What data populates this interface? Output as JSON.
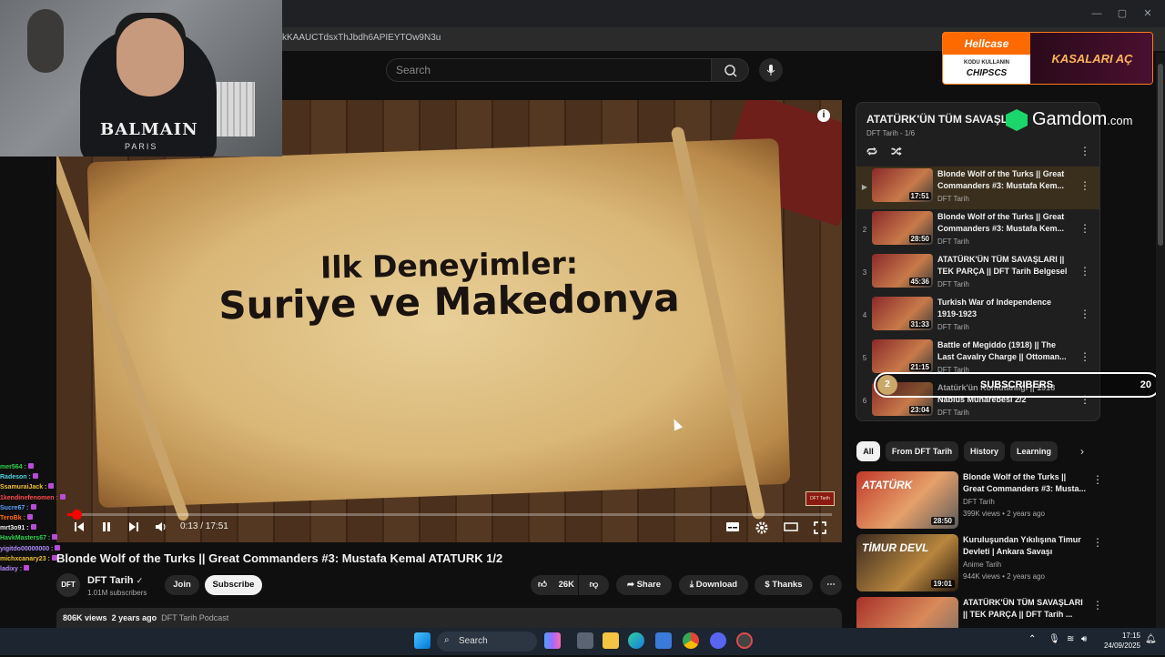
{
  "browser": {
    "url": "kKAAUCTdsxThJbdh6APIEYTOw9N3u",
    "window_controls": [
      "—",
      "▢",
      "✕"
    ]
  },
  "webcam": {
    "shirt_text": "BALMAIN",
    "shirt_sub": "PARIS"
  },
  "search": {
    "placeholder": "Search"
  },
  "ad_hellcase": {
    "brand": "Hellcase",
    "code_label": "KODU KULLANIN",
    "code": "CHIPSCS",
    "cta": "KASALARI AÇ"
  },
  "gamdom": {
    "name": "Gamdom",
    "suffix": ".com"
  },
  "player": {
    "overlay_line1": "Ilk Deneyimler:",
    "overlay_line2": "Suriye ve Makedonya",
    "time": "0:13 / 17:51",
    "progress": 0.012,
    "watermark": "DFT Tarih",
    "info_icon": "i"
  },
  "video": {
    "title": "Blonde Wolf of the Turks || Great Commanders #3: Mustafa Kemal ATATURK 1/2",
    "channel": "DFT Tarih",
    "channel_avatar": "DFT",
    "subscribers": "1.01M subscribers",
    "join": "Join",
    "subscribe": "Subscribe",
    "likes": "26K",
    "share": "Share",
    "download": "Download",
    "thanks": "Thanks",
    "views": "806K views",
    "age": "2 years ago",
    "playlist_link": "DFT Tarih Podcast"
  },
  "chat": [
    {
      "user": "mer564 :",
      "color": "#29d14a"
    },
    {
      "user": "Radeson :",
      "color": "#49d3e3"
    },
    {
      "user": "SsamuraiJack :",
      "color": "#f1c232"
    },
    {
      "user": "1kendinefenomen :",
      "color": "#ff4a4a"
    },
    {
      "user": "Sucre67 :",
      "color": "#5aa0ff"
    },
    {
      "user": "TeroBk :",
      "color": "#ff6a00"
    },
    {
      "user": "mrt3o91 :",
      "color": "#f1f1f1"
    },
    {
      "user": "HavkMasters67 :",
      "color": "#29d14a"
    },
    {
      "user": "yigitdo00000000 :",
      "color": "#b18cff"
    },
    {
      "user": "michxcanary23 :",
      "color": "#f1c232"
    },
    {
      "user": "ladixy :",
      "color": "#b18cff"
    }
  ],
  "playlist": {
    "title": "ATATÜRK'ÜN TÜM SAVAŞLARI",
    "subtitle": "DFT Tarih - 1/6",
    "items": [
      {
        "idx": "▶",
        "title": "Blonde Wolf of the Turks || Great Commanders #3: Mustafa Kem...",
        "channel": "DFT Tarih",
        "duration": "17:51"
      },
      {
        "idx": "2",
        "title": "Blonde Wolf of the Turks || Great Commanders #3: Mustafa Kem...",
        "channel": "DFT Tarih",
        "duration": "28:50"
      },
      {
        "idx": "3",
        "title": "ATATÜRK'ÜN TÜM SAVAŞLARI || TEK PARÇA || DFT Tarih Belgesel",
        "channel": "DFT Tarih",
        "duration": "45:36"
      },
      {
        "idx": "4",
        "title": "Turkish War of Independence 1919-1923",
        "channel": "DFT Tarih",
        "duration": "31:33"
      },
      {
        "idx": "5",
        "title": "Battle of Megiddo (1918) || The Last Cavalry Charge || Ottoman...",
        "channel": "DFT Tarih",
        "duration": "21:15"
      },
      {
        "idx": "6",
        "title": "Atatürk'ün Komutanlığı || 1918 Nablus Muharebesi 2/2",
        "channel": "DFT Tarih",
        "duration": "23:04"
      }
    ]
  },
  "sub_goal": {
    "current": "2",
    "label": "SUBSCRIBERS",
    "goal": "20"
  },
  "chips": [
    "All",
    "From DFT Tarih",
    "History",
    "Learning"
  ],
  "recommendations": [
    {
      "title": "Blonde Wolf of the Turks || Great Commanders #3: Musta...",
      "channel": "DFT Tarih",
      "meta": "399K views • 2 years ago",
      "duration": "28:50",
      "thumb_text": "ATATÜRK"
    },
    {
      "title": "Kuruluşundan Yıkılışına Timur Devleti | Ankara Savaşı",
      "channel": "Anime Tarih",
      "meta": "944K views • 2 years ago",
      "duration": "19:01",
      "thumb_text": "TİMUR DEVL"
    },
    {
      "title": "ATATÜRK'ÜN TÜM SAVAŞLARI || TEK PARÇA || DFT Tarih ...",
      "channel": "",
      "meta": "",
      "duration": "",
      "thumb_text": ""
    }
  ],
  "taskbar": {
    "search": "Search",
    "time": "17:15",
    "date": "24/09/2025"
  }
}
